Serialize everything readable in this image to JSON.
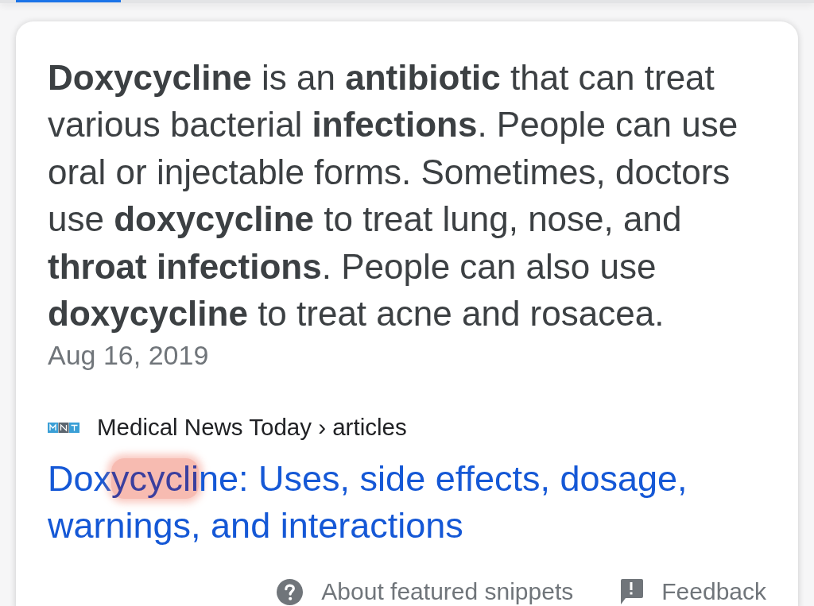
{
  "snippet": {
    "text": "**Doxycycline** is an **antibiotic** that can treat various bacterial **infections**. People can use oral or injectable forms. Sometimes, doctors use **doxycycline** to treat lung, nose, and **throat infections**. People can also use **doxycycline** to treat acne and rosacea.",
    "date": "Aug 16, 2019"
  },
  "source": {
    "label": "Medical News Today › articles"
  },
  "result_title": {
    "segments": [
      {
        "text": "Dox",
        "highlighted": false
      },
      {
        "text": "ycycli",
        "highlighted": true
      },
      {
        "text": "ne: Uses, side effects, dosage, warnings, and interactions",
        "highlighted": false
      }
    ]
  },
  "footer": {
    "links": [
      {
        "kind": "about",
        "label": "About featured snippets"
      },
      {
        "kind": "feedback",
        "label": "Feedback"
      }
    ]
  }
}
